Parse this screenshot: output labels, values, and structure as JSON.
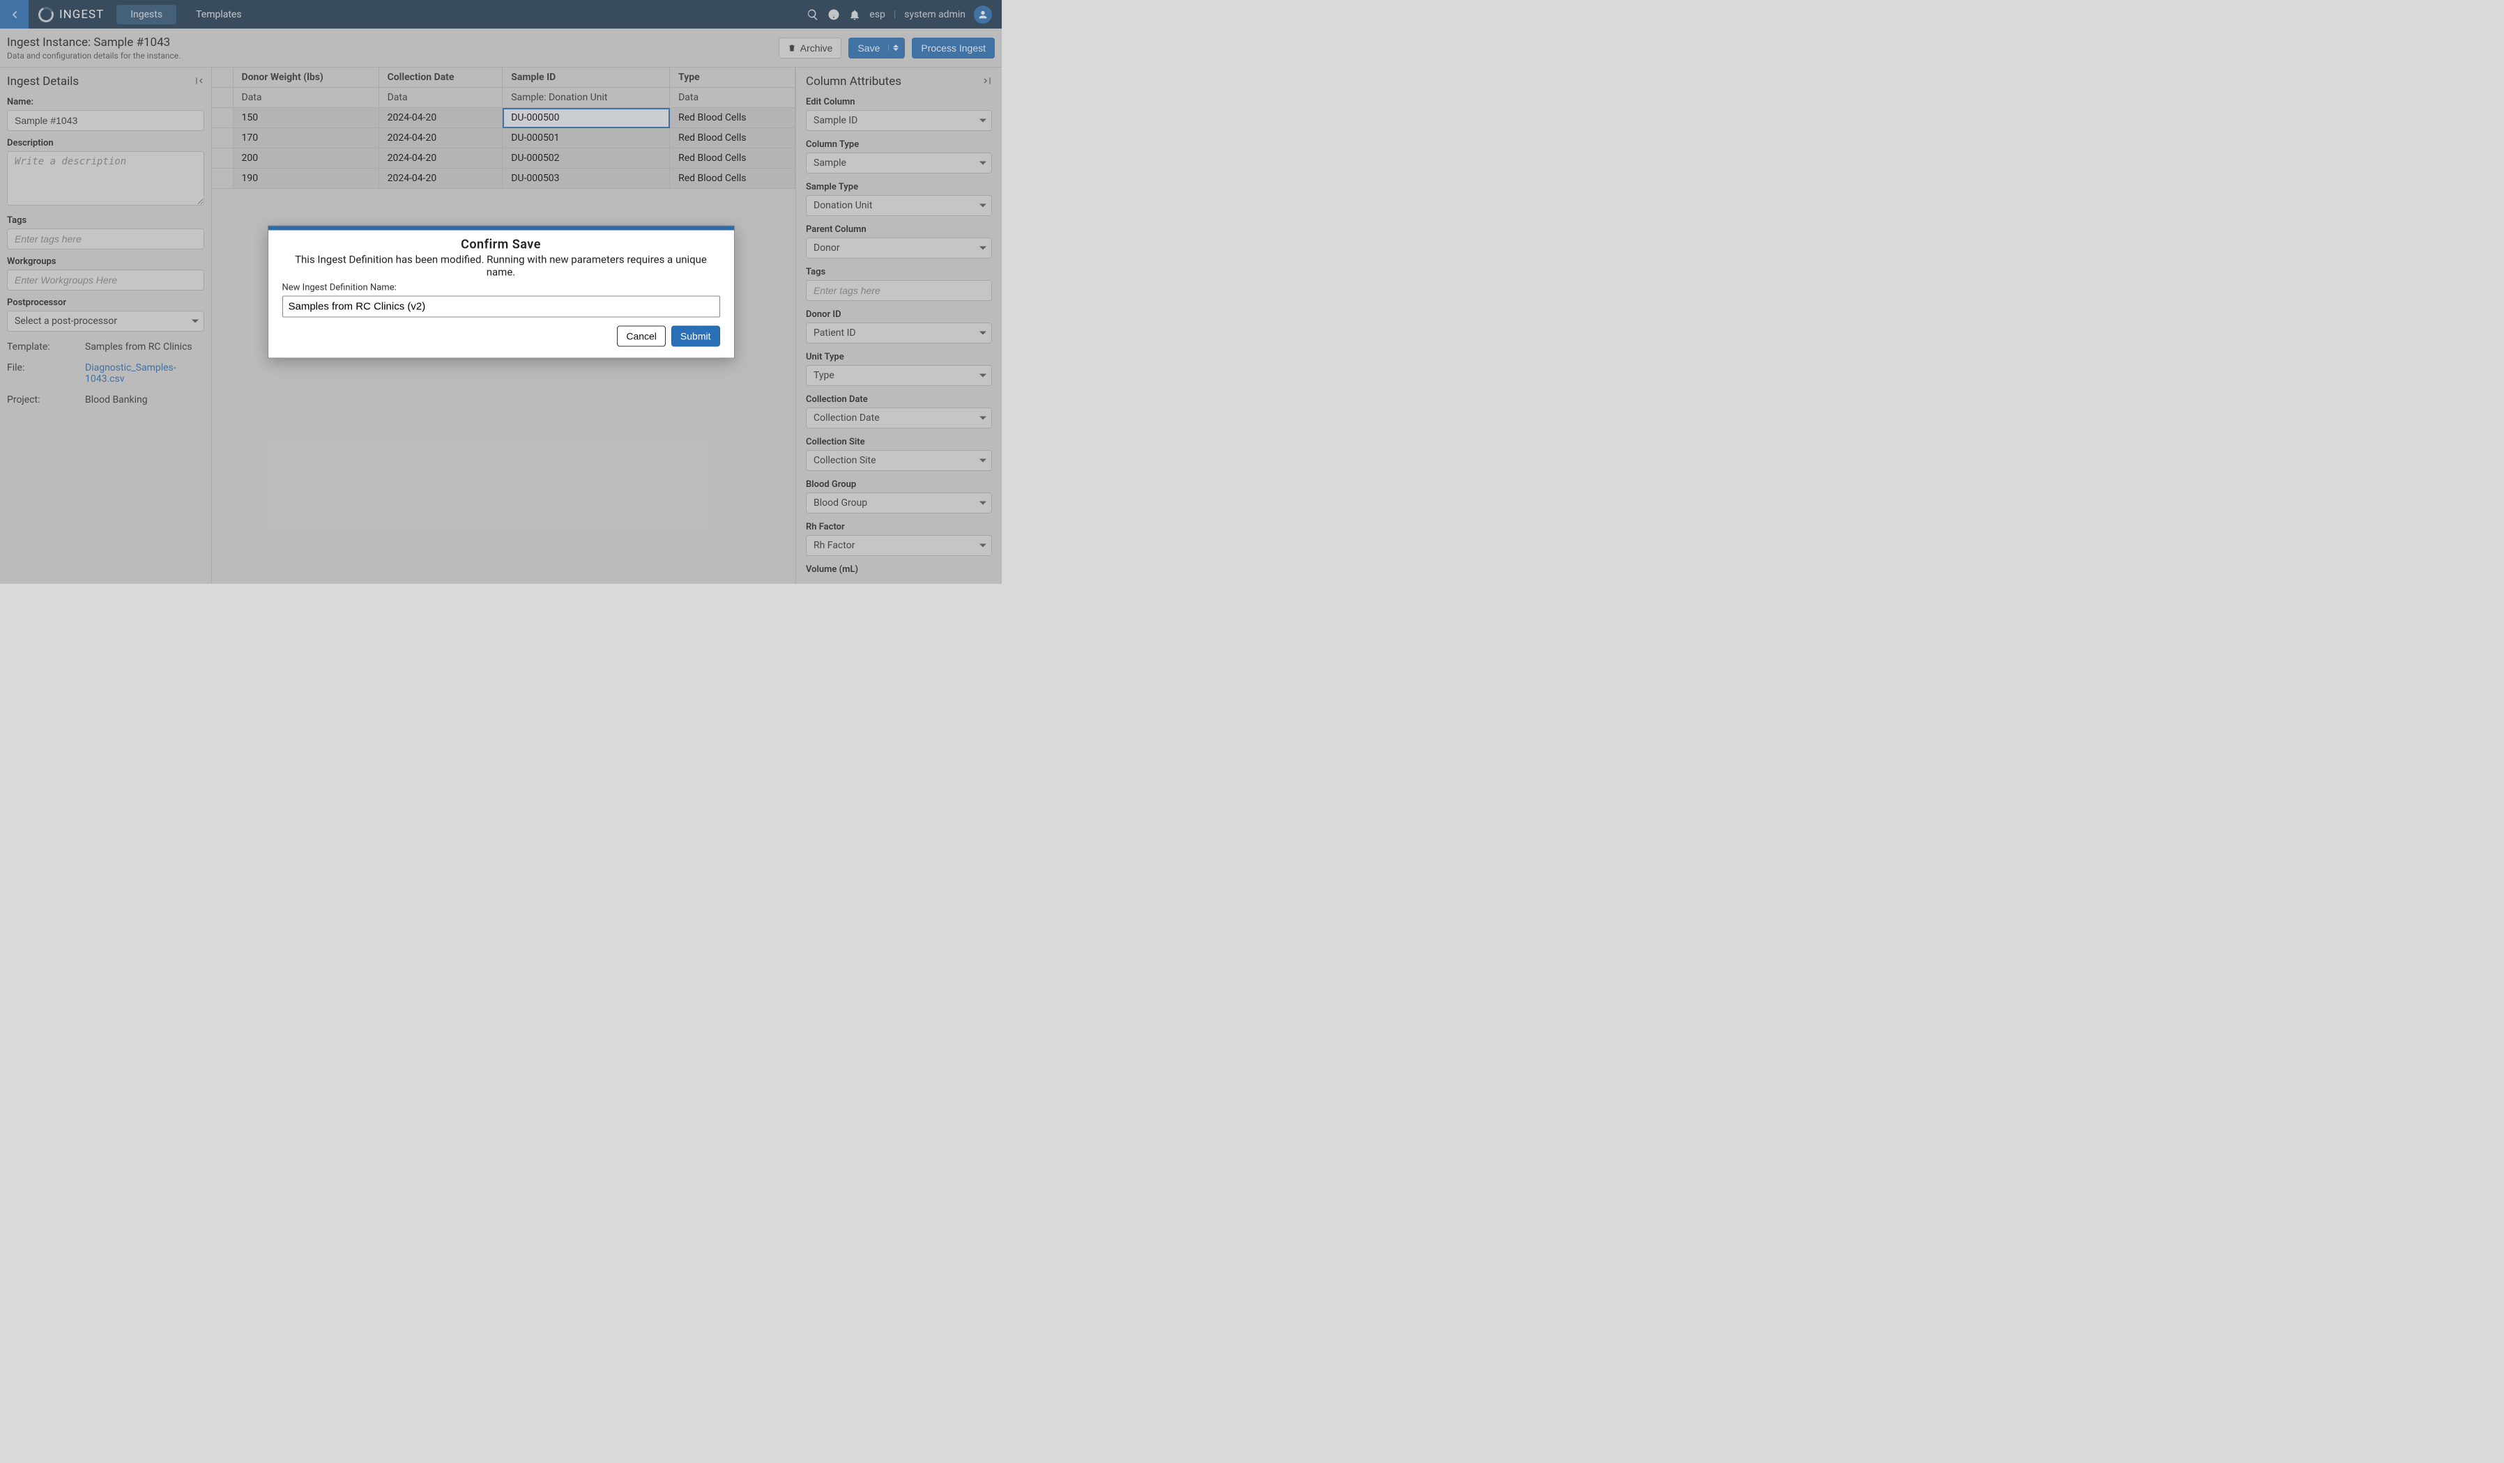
{
  "nav": {
    "app_title": "INGEST",
    "tabs": [
      {
        "label": "Ingests",
        "active": true
      },
      {
        "label": "Templates",
        "active": false
      }
    ],
    "env": "esp",
    "user": "system admin"
  },
  "header": {
    "title": "Ingest Instance: Sample #1043",
    "subtitle": "Data and configuration details for the instance.",
    "archive_label": "Archive",
    "save_label": "Save",
    "process_label": "Process Ingest"
  },
  "left": {
    "panel_title": "Ingest Details",
    "name_label": "Name:",
    "name_value": "Sample #1043",
    "description_label": "Description",
    "description_placeholder": "Write a description",
    "description_value": "",
    "tags_label": "Tags",
    "tags_placeholder": "Enter tags here",
    "workgroups_label": "Workgroups",
    "workgroups_placeholder": "Enter Workgroups Here",
    "postprocessor_label": "Postprocessor",
    "postprocessor_value": "Select a post-processor",
    "meta": {
      "template_label": "Template:",
      "template_value": "Samples from RC Clinics",
      "file_label": "File:",
      "file_value_line1": "Diagnostic_Samples-",
      "file_value_line2": "1043.csv",
      "project_label": "Project:",
      "project_value": "Blood Banking"
    }
  },
  "table": {
    "columns": [
      {
        "header1": "Donor Weight (lbs)",
        "header2": "Data"
      },
      {
        "header1": "Collection Date",
        "header2": "Data"
      },
      {
        "header1": "Sample ID",
        "header2": "Sample: Donation Unit"
      },
      {
        "header1": "Type",
        "header2": "Data"
      }
    ],
    "rows": [
      {
        "c0": "150",
        "c1": "2024-04-20",
        "c2": "DU-000500",
        "c3": "Red Blood Cells"
      },
      {
        "c0": "170",
        "c1": "2024-04-20",
        "c2": "DU-000501",
        "c3": "Red Blood Cells"
      },
      {
        "c0": "200",
        "c1": "2024-04-20",
        "c2": "DU-000502",
        "c3": "Red Blood Cells"
      },
      {
        "c0": "190",
        "c1": "2024-04-20",
        "c2": "DU-000503",
        "c3": "Red Blood Cells"
      }
    ],
    "selected": {
      "row": 0,
      "col": 2
    }
  },
  "right": {
    "panel_title": "Column Attributes",
    "fields": [
      {
        "label": "Edit Column",
        "value": "Sample ID"
      },
      {
        "label": "Column Type",
        "value": "Sample"
      },
      {
        "label": "Sample Type",
        "value": "Donation Unit"
      },
      {
        "label": "Parent Column",
        "value": "Donor"
      },
      {
        "label": "Tags",
        "value": "",
        "placeholder": "Enter tags here",
        "is_text": true
      },
      {
        "label": "Donor ID",
        "value": "Patient ID"
      },
      {
        "label": "Unit Type",
        "value": "Type"
      },
      {
        "label": "Collection Date",
        "value": "Collection Date"
      },
      {
        "label": "Collection Site",
        "value": "Collection Site"
      },
      {
        "label": "Blood Group",
        "value": "Blood Group"
      },
      {
        "label": "Rh Factor",
        "value": "Rh Factor"
      },
      {
        "label": "Volume (mL)",
        "value": ""
      }
    ]
  },
  "modal": {
    "title": "Confirm Save",
    "message": "This Ingest Definition has been modified. Running with new parameters requires a unique name.",
    "input_label": "New Ingest Definition Name:",
    "input_value": "Samples from RC Clinics (v2)",
    "cancel_label": "Cancel",
    "submit_label": "Submit"
  }
}
